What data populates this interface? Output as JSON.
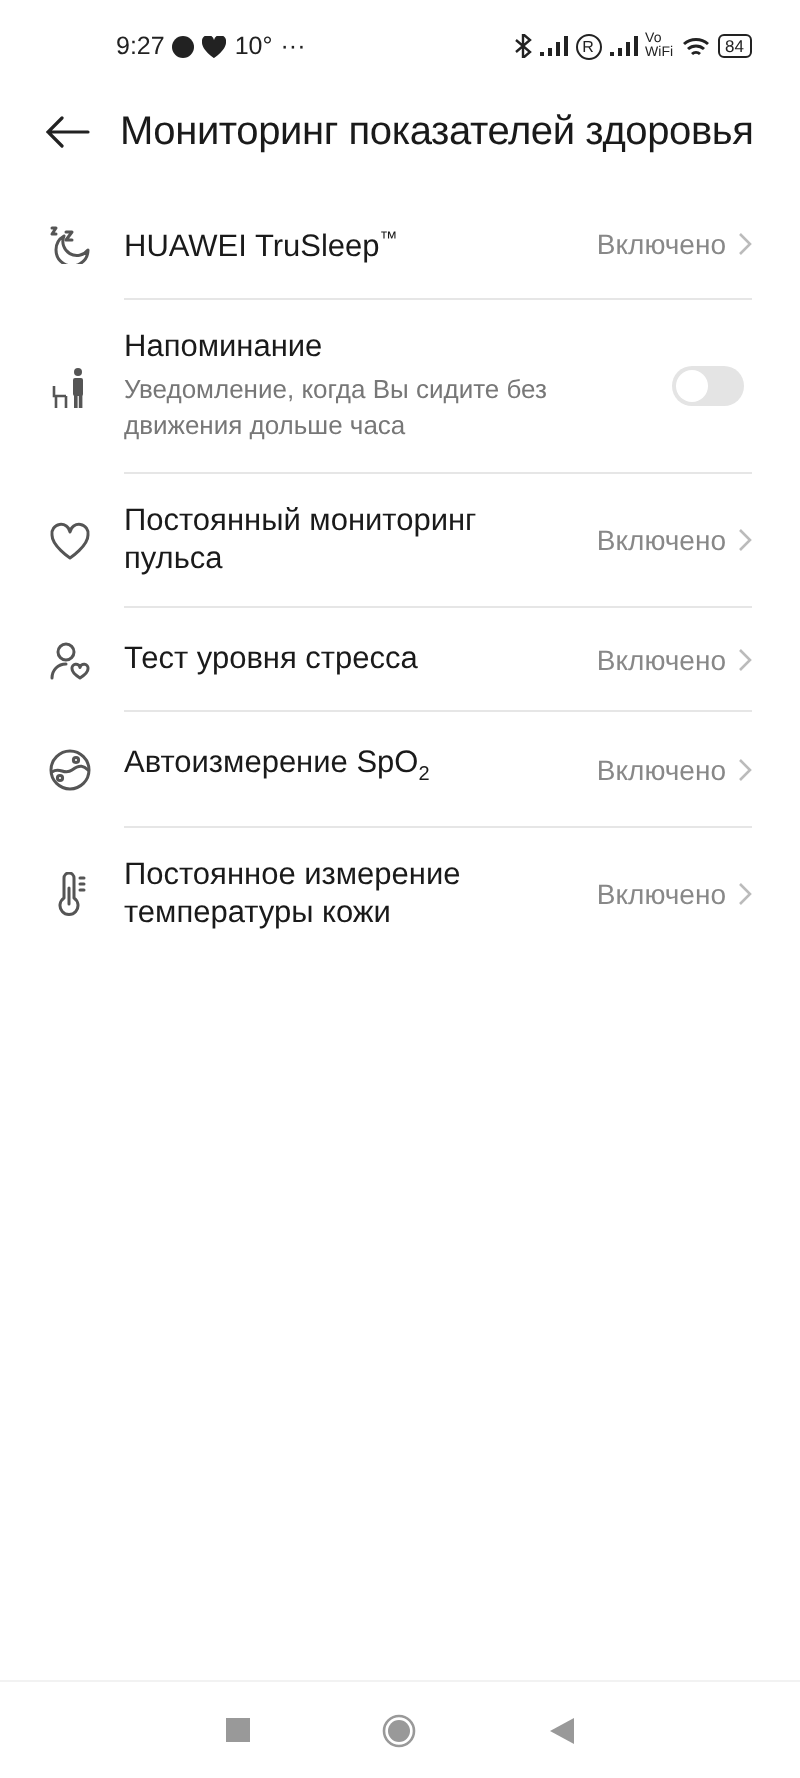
{
  "status_bar": {
    "time": "9:27",
    "temperature": "10°",
    "more": "···",
    "roaming": "R",
    "vowifi": [
      "Vo",
      "WiFi"
    ],
    "battery": "84"
  },
  "header": {
    "title": "Мониторинг показателей здоровья"
  },
  "items": [
    {
      "kind": "link",
      "title": "HUAWEI TruSleep$^{™}$",
      "value": "Включено"
    },
    {
      "kind": "toggle",
      "title": "Напоминание",
      "subtitle": "Уведомление, когда Вы сидите без движения дольше часа",
      "on": false
    },
    {
      "kind": "link",
      "title": "Постоянный мониторинг пульса",
      "value": "Включено"
    },
    {
      "kind": "link",
      "title": "Тест уровня стресса",
      "value": "Включено"
    },
    {
      "kind": "link",
      "title": "Автоизмерение SpO$_{2}$",
      "value": "Включено"
    },
    {
      "kind": "link",
      "title": "Постоянное измерение температуры кожи",
      "value": "Включено"
    }
  ]
}
